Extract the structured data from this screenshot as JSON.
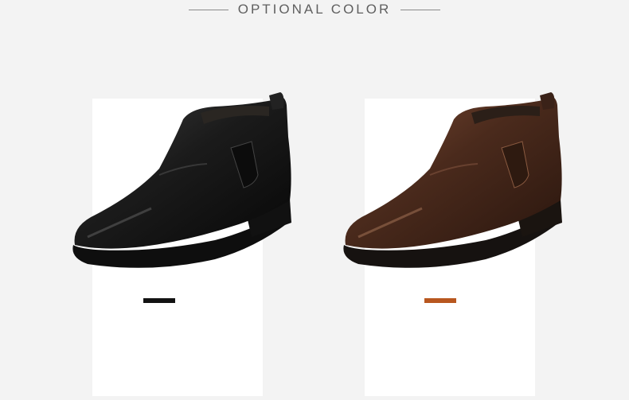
{
  "header": {
    "title": "OPTIONAL COLOR"
  },
  "products": [
    {
      "color_name": "black",
      "swatch_color": "#121212",
      "leather": "#1b1b1b",
      "leather_hi": "#3d3d3d",
      "sole": "#0e0e0e"
    },
    {
      "color_name": "brown",
      "swatch_color": "#b8571f",
      "leather": "#4a2a1c",
      "leather_hi": "#7a4a34",
      "sole": "#161210"
    }
  ],
  "colors": {
    "background": "#f3f3f3",
    "card": "#ffffff",
    "header_text": "#5f5f5f",
    "rule": "#8a8a8a"
  }
}
